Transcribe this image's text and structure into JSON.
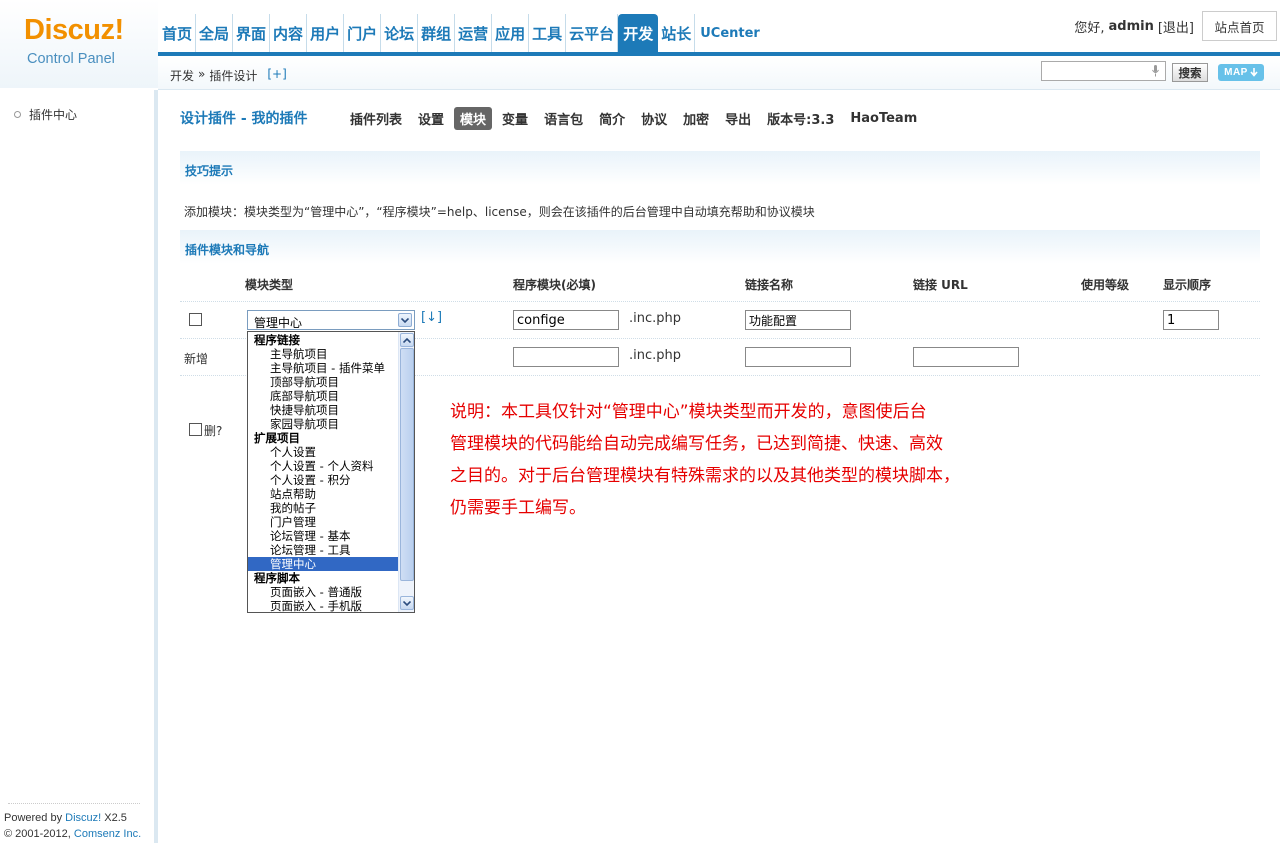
{
  "logo": {
    "brand": "Discuz!",
    "subtitle": "Control Panel"
  },
  "topnav": {
    "items": [
      "首页",
      "全局",
      "界面",
      "内容",
      "用户",
      "门户",
      "论坛",
      "群组",
      "运营",
      "应用",
      "工具",
      "云平台",
      "开发",
      "站长",
      "UCenter"
    ],
    "active": "开发"
  },
  "user": {
    "greeting": "您好,",
    "name": "admin",
    "logout": "[退出]",
    "site_home": "站点首页"
  },
  "breadcrumb": {
    "part1": "开发",
    "sep": "»",
    "part2": "插件设计",
    "plus": "[+]"
  },
  "search": {
    "value": "",
    "button": "搜索",
    "map": "MAP"
  },
  "sidebar": {
    "item": "插件中心"
  },
  "footer": {
    "powered_prefix": "Powered by ",
    "powered_brand": "Discuz!",
    "powered_ver": " X2.5",
    "copyright_prefix": "© 2001-2012, ",
    "copyright_company": "Comsenz Inc."
  },
  "page": {
    "title": "设计插件 - 我的插件",
    "tabs": [
      "插件列表",
      "设置",
      "模块",
      "变量",
      "语言包",
      "简介",
      "协议",
      "加密",
      "导出"
    ],
    "active_tab": "模块",
    "version": "版本号:3.3",
    "team": "HaoTeam"
  },
  "tips": {
    "title": "技巧提示",
    "text": "添加模块：模块类型为“管理中心”，“程序模块”=help、license，则会在该插件的后台管理中自动填充帮助和协议模块"
  },
  "module_section": {
    "title": "插件模块和导航"
  },
  "table": {
    "headers": [
      "模块类型",
      "程序模块(必填)",
      "链接名称",
      "链接 URL",
      "使用等级",
      "显示顺序"
    ],
    "row1": {
      "type_selected": "管理中心",
      "sort_link": "[↓]",
      "program": "configе",
      "suffix": ".inc.php",
      "link_name": "功能配置",
      "order": "1"
    },
    "new_row": {
      "label": "新增",
      "program": "",
      "suffix": ".inc.php",
      "link_name": "",
      "url": ""
    },
    "delete_label": "删?"
  },
  "dropdown": {
    "options": [
      {
        "label": "程序链接",
        "kind": "group"
      },
      {
        "label": "主导航项目",
        "kind": "child"
      },
      {
        "label": "主导航项目 - 插件菜单",
        "kind": "child"
      },
      {
        "label": "顶部导航项目",
        "kind": "child"
      },
      {
        "label": "底部导航项目",
        "kind": "child"
      },
      {
        "label": "快捷导航项目",
        "kind": "child"
      },
      {
        "label": "家园导航项目",
        "kind": "child"
      },
      {
        "label": "扩展项目",
        "kind": "group"
      },
      {
        "label": "个人设置",
        "kind": "child"
      },
      {
        "label": "个人设置 - 个人资料",
        "kind": "child"
      },
      {
        "label": "个人设置 - 积分",
        "kind": "child"
      },
      {
        "label": "站点帮助",
        "kind": "child"
      },
      {
        "label": "我的帖子",
        "kind": "child"
      },
      {
        "label": "门户管理",
        "kind": "child"
      },
      {
        "label": "论坛管理 - 基本",
        "kind": "child"
      },
      {
        "label": "论坛管理 - 工具",
        "kind": "child"
      },
      {
        "label": "管理中心",
        "kind": "selected"
      },
      {
        "label": "程序脚本",
        "kind": "group"
      },
      {
        "label": "页面嵌入 - 普通版",
        "kind": "child"
      },
      {
        "label": "页面嵌入 - 手机版",
        "kind": "child"
      }
    ]
  },
  "annotation": {
    "lines": [
      "说明：本工具仅针对“管理中心”模块类型而开发的，意图使后台",
      "管理模块的代码能给自动完成编写任务，已达到简捷、快速、高效",
      "之目的。对于后台管理模块有特殊需求的以及其他类型的模块脚本，",
      "仍需要手工编写。"
    ]
  },
  "colors": {
    "accent": "#1d7ab8",
    "logo_orange": "#f29000",
    "annotation_red": "#e60000",
    "selected_option": "#3168c4"
  },
  "icons": {
    "mic": "microphone-icon",
    "map_arrow": "arrow-down-icon",
    "dropdown": "chevron-down-icon"
  }
}
